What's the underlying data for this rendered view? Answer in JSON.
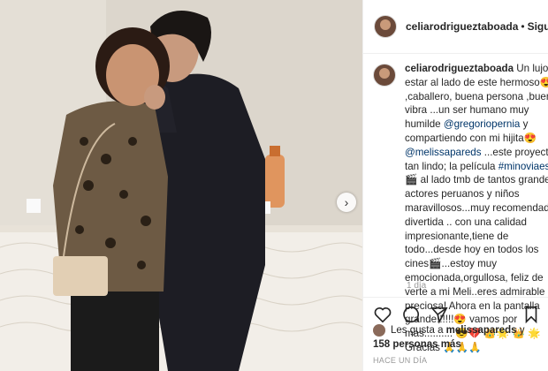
{
  "post": {
    "username": "celiarodrigueztaboada",
    "follow_separator": "•",
    "follow_label": "Siguiendo"
  },
  "caption": {
    "username": "celiarodrigueztaboada",
    "line1": " Un lujo estar al lado de este hermoso😍 ,caballero, buena persona ,buena vibra ...un ser humano muy humilde ",
    "mention1": "@gregoriopernia",
    "line2": " y compartiendo con mi hijita😍 ",
    "mention2": "@melissapareds",
    "line3": " ...este proyecto tan lindo; la película ",
    "hashtag": "#minoviaesel",
    "line4": "🎬 al lado tmb de tantos grandes actores peruanos y niños maravillosos...muy recomendada divertida .. con una calidad impresionante,tiene de todo...desde hoy en todos los cines🎬...estoy muy emocionada,orgullosa, feliz de verte a mi Meli..eres admirable preciosa! Ahora en la pantalla grande!!!!!!😍 vamos por mas.......... 😎💔 👑🌟 👑 🌟Gracias 🙏🙏🙏",
    "time_ago": "1 día"
  },
  "likes": {
    "prefix": "Les gusta a ",
    "user": "melissapareds",
    "connector": " y",
    "count_text": "158 personas más"
  },
  "date_label": "HACE UN DÍA",
  "icons": [
    "heart-icon",
    "comment-icon",
    "share-icon",
    "bookmark-icon",
    "next-arrow-icon"
  ],
  "colors": {
    "link": "#003569",
    "muted": "#999999",
    "border": "#efefef"
  }
}
